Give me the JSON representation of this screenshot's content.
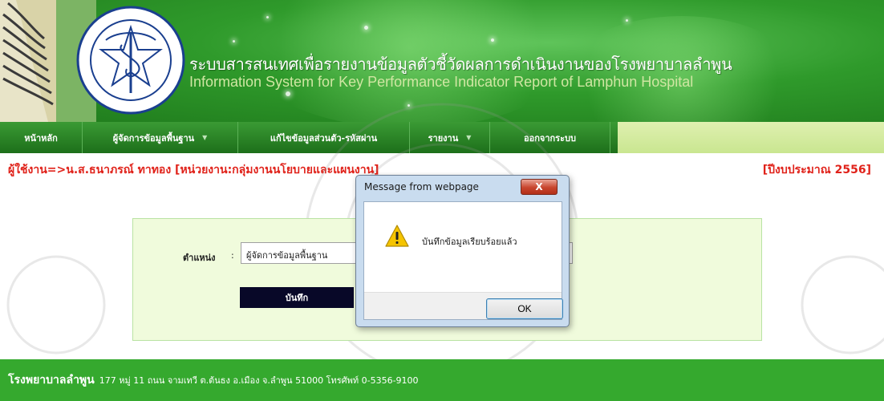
{
  "header": {
    "title_th": "ระบบสารสนเทศเพื่อรายงานข้อมูลตัวชี้วัดผลการดำเนินงานของโรงพยาบาลลำพูน",
    "title_en": "Information System for Key Performance Indicator Report of Lamphun Hospital",
    "logo_text": "โรงพยาบาลลำพูน"
  },
  "nav": {
    "items": [
      {
        "label": "หน้าหลัก",
        "dropdown": false
      },
      {
        "label": "ผู้จัดการข้อมูลพื้นฐาน",
        "dropdown": true
      },
      {
        "label": "แก้ไขข้อมูลส่วนตัว-รหัสผ่าน",
        "dropdown": false
      },
      {
        "label": "รายงาน",
        "dropdown": true
      },
      {
        "label": "ออกจากระบบ",
        "dropdown": false
      }
    ]
  },
  "user_line": {
    "text": "ผู้ใช้งาน=>น.ส.ธนาภรณ์  ทาทอง  [หน่วยงาน:กลุ่มงานนโยบายและแผนงาน]",
    "year": "[ปีงบประมาณ  2556]"
  },
  "form": {
    "position_label": "ตำแหน่ง",
    "colon": ":",
    "position_value": "ผู้จัดการข้อมูลพื้นฐาน",
    "save_label": "บันทึก"
  },
  "footer": {
    "brand": "โรงพยาบาลลำพูน",
    "address": "177 หมู่ 11 ถนน จามเทวี ต.ต้นธง อ.เมือง จ.ลำพูน 51000 โทรศัพท์ 0-5356-9100"
  },
  "dialog": {
    "title": "Message from webpage",
    "close_label": "X",
    "message": "บันทึกข้อมูลเรียบร้อยแล้ว",
    "ok_label": "OK"
  },
  "colors": {
    "header_green": "#2f9a2b",
    "nav_green": "#1d6f1a",
    "user_text_red": "#e0221a",
    "form_bg": "#f0fbdc",
    "footer_green": "#35a92e",
    "save_button": "#080828"
  }
}
